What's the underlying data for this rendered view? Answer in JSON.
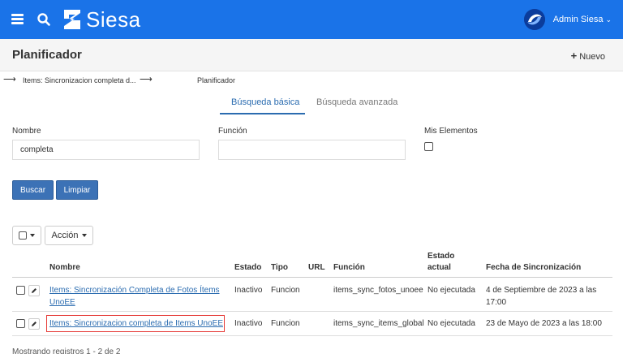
{
  "app": {
    "brand": "Siesa",
    "user_name": "Admin Siesa"
  },
  "header": {
    "title": "Planificador",
    "new_label": "Nuevo"
  },
  "breadcrumb": {
    "item1": "Items: Sincronizacion completa d...",
    "item2": "Planificador"
  },
  "tabs": {
    "basic": "Búsqueda básica",
    "advanced": "Búsqueda avanzada"
  },
  "form": {
    "nombre_label": "Nombre",
    "nombre_value": "completa",
    "funcion_label": "Función",
    "funcion_value": "",
    "mis_elementos_label": "Mis Elementos",
    "buscar_label": "Buscar",
    "limpiar_label": "Limpiar"
  },
  "toolbar": {
    "accion_label": "Acción"
  },
  "table": {
    "headers": {
      "nombre": "Nombre",
      "estado": "Estado",
      "tipo": "Tipo",
      "url": "URL",
      "funcion": "Función",
      "estado_actual_1": "Estado",
      "estado_actual_2": "actual",
      "fecha": "Fecha de Sincronización"
    },
    "rows": [
      {
        "nombre_line1": "Items: Sincronización Completa de Fotos Ítems",
        "nombre_line2": "UnoEE",
        "estado": "Inactivo",
        "tipo": "Funcion",
        "url": "",
        "funcion": "items_sync_fotos_unoee",
        "estado_actual": "No ejecutada",
        "fecha_line1": "4 de Septiembre de 2023 a las",
        "fecha_line2": "17:00"
      },
      {
        "nombre_line1": "Items: Sincronizacion completa de Items UnoEE",
        "estado": "Inactivo",
        "tipo": "Funcion",
        "url": "",
        "funcion": "items_sync_items_global",
        "estado_actual": "No ejecutada",
        "fecha_line1": "23 de Mayo de 2023 a las 18:00"
      }
    ]
  },
  "footer": {
    "records": "Mostrando registros 1 - 2 de 2"
  },
  "colors": {
    "topbar": "#1a73e8",
    "primary_button": "#3c72b6",
    "link": "#2b6cb0",
    "highlight": "#e53935"
  }
}
